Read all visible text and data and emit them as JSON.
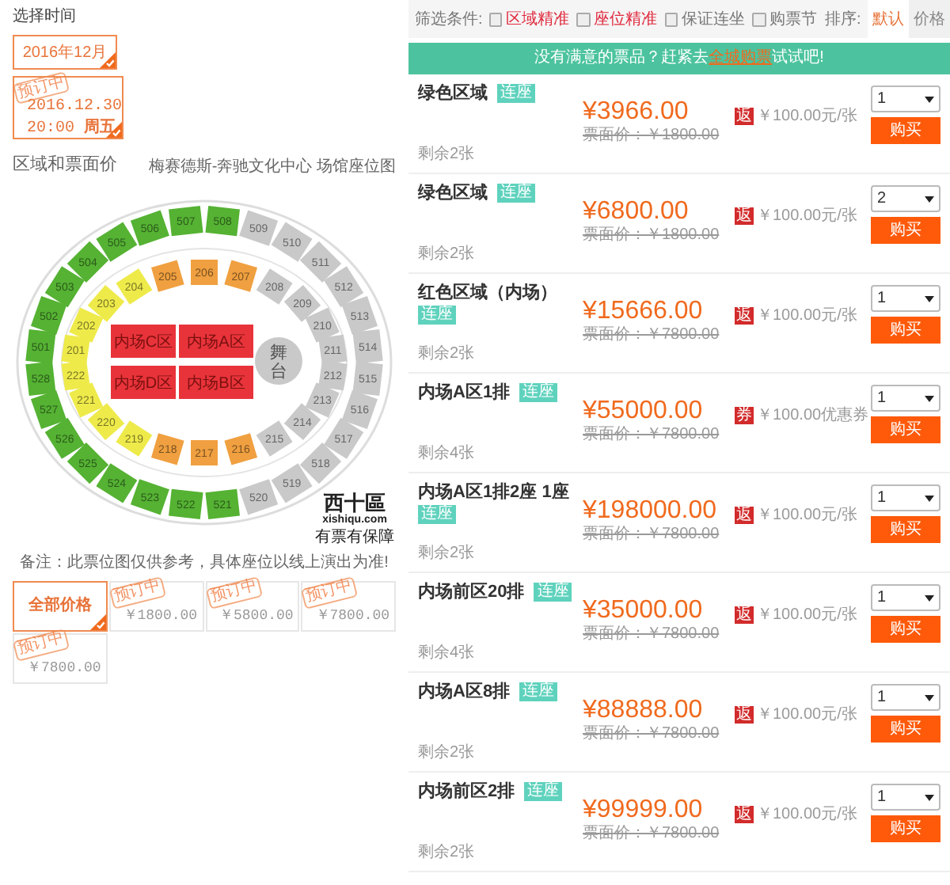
{
  "left": {
    "time_heading": "选择时间",
    "time_options": [
      {
        "label": "2016年12月",
        "selected": true
      }
    ],
    "sessions": [
      {
        "date": "2016.12.30",
        "time": "20:00",
        "weekday": "周五",
        "stamp": "预订中",
        "selected": true
      }
    ],
    "zone_heading": "区域和票面价",
    "venue_map_title": "梅赛德斯-奔驰文化中心 场馆座位图",
    "seat_map": {
      "outer_ring": [
        {
          "label": "501",
          "color": "#55b233"
        },
        {
          "label": "502",
          "color": "#55b233"
        },
        {
          "label": "503",
          "color": "#55b233"
        },
        {
          "label": "504",
          "color": "#55b233"
        },
        {
          "label": "505",
          "color": "#55b233"
        },
        {
          "label": "506",
          "color": "#55b233"
        },
        {
          "label": "507",
          "color": "#55b233"
        },
        {
          "label": "508",
          "color": "#55b233"
        },
        {
          "label": "509",
          "color": "#c9c9c9"
        },
        {
          "label": "510",
          "color": "#c9c9c9"
        },
        {
          "label": "511",
          "color": "#c9c9c9"
        },
        {
          "label": "512",
          "color": "#c9c9c9"
        },
        {
          "label": "513",
          "color": "#c9c9c9"
        },
        {
          "label": "514",
          "color": "#c9c9c9"
        },
        {
          "label": "515",
          "color": "#c9c9c9"
        },
        {
          "label": "516",
          "color": "#c9c9c9"
        },
        {
          "label": "517",
          "color": "#c9c9c9"
        },
        {
          "label": "518",
          "color": "#c9c9c9"
        },
        {
          "label": "519",
          "color": "#c9c9c9"
        },
        {
          "label": "520",
          "color": "#c9c9c9"
        },
        {
          "label": "521",
          "color": "#55b233"
        },
        {
          "label": "522",
          "color": "#55b233"
        },
        {
          "label": "523",
          "color": "#55b233"
        },
        {
          "label": "524",
          "color": "#55b233"
        },
        {
          "label": "525",
          "color": "#55b233"
        },
        {
          "label": "526",
          "color": "#55b233"
        },
        {
          "label": "527",
          "color": "#55b233"
        },
        {
          "label": "528",
          "color": "#55b233"
        }
      ],
      "middle_ring": [
        {
          "label": "201",
          "color": "#eeea4a"
        },
        {
          "label": "202",
          "color": "#eeea4a"
        },
        {
          "label": "203",
          "color": "#eeea4a"
        },
        {
          "label": "204",
          "color": "#eeea4a"
        },
        {
          "label": "205",
          "color": "#f0a040"
        },
        {
          "label": "206",
          "color": "#f0a040"
        },
        {
          "label": "207",
          "color": "#f0a040"
        },
        {
          "label": "208",
          "color": "#c9c9c9"
        },
        {
          "label": "209",
          "color": "#c9c9c9"
        },
        {
          "label": "210",
          "color": "#c9c9c9"
        },
        {
          "label": "211",
          "color": "#c9c9c9"
        },
        {
          "label": "212",
          "color": "#c9c9c9"
        },
        {
          "label": "213",
          "color": "#c9c9c9"
        },
        {
          "label": "214",
          "color": "#c9c9c9"
        },
        {
          "label": "215",
          "color": "#c9c9c9"
        },
        {
          "label": "216",
          "color": "#f0a040"
        },
        {
          "label": "217",
          "color": "#f0a040"
        },
        {
          "label": "218",
          "color": "#f0a040"
        },
        {
          "label": "219",
          "color": "#eeea4a"
        },
        {
          "label": "220",
          "color": "#eeea4a"
        },
        {
          "label": "221",
          "color": "#eeea4a"
        },
        {
          "label": "222",
          "color": "#eeea4a"
        }
      ],
      "floor_blocks": [
        {
          "label": "内场C区",
          "color": "#e8333a"
        },
        {
          "label": "内场A区",
          "color": "#e8333a"
        },
        {
          "label": "内场D区",
          "color": "#e8333a"
        },
        {
          "label": "内场B区",
          "color": "#e8333a"
        }
      ],
      "stage": "舞台",
      "logo": {
        "wordmark": "西十區",
        "url": "xishiqu.com",
        "slogan": "有票有保障"
      }
    },
    "note": "备注：此票位图仅供参考，具体座位以线上演出为准!",
    "price_filters": [
      {
        "label": "全部价格",
        "selected": true
      },
      {
        "label": "￥1800.00",
        "stamp": "预订中",
        "selected": false
      },
      {
        "label": "￥5800.00",
        "stamp": "预订中",
        "selected": false
      },
      {
        "label": "￥7800.00",
        "stamp": "预订中",
        "selected": false
      },
      {
        "label": "￥7800.00",
        "stamp": "预订中",
        "selected": false
      }
    ]
  },
  "filters": {
    "label": "筛选条件:",
    "options": [
      {
        "label": "区域精准",
        "checked": false,
        "highlight": true
      },
      {
        "label": "座位精准",
        "checked": false,
        "highlight": true
      },
      {
        "label": "保证连坐",
        "checked": false,
        "highlight": false
      },
      {
        "label": "购票节",
        "checked": false,
        "highlight": false
      }
    ],
    "sort_label": "排序:",
    "sort_tabs": [
      {
        "label": "默认",
        "selected": true
      },
      {
        "label": "价格",
        "selected": false
      }
    ]
  },
  "banner": {
    "before": "没有满意的票品？赶紧去",
    "link": "全城购票",
    "after": "试试吧!"
  },
  "listings": [
    {
      "name": "绿色区域",
      "badge": "连座",
      "price": "¥3966.00",
      "face_price": "票面价：￥1800.00",
      "rebate_icon": "返",
      "rebate": "￥100.00元/张",
      "remaining": "剩余2张",
      "quantity": "1",
      "button": "购买"
    },
    {
      "name": "绿色区域",
      "badge": "连座",
      "price": "¥6800.00",
      "face_price": "票面价：￥1800.00",
      "rebate_icon": "返",
      "rebate": "￥100.00元/张",
      "remaining": "剩余2张",
      "quantity": "2",
      "button": "购买"
    },
    {
      "name": "红色区域（内场）",
      "badge": "连座",
      "price": "¥15666.00",
      "face_price": "票面价：￥7800.00",
      "rebate_icon": "返",
      "rebate": "￥100.00元/张",
      "remaining": "剩余2张",
      "quantity": "1",
      "button": "购买"
    },
    {
      "name": "内场A区1排",
      "badge": "连座",
      "price": "¥55000.00",
      "face_price": "票面价：￥7800.00",
      "rebate_icon": "券",
      "rebate": "￥100.00优惠券",
      "remaining": "剩余4张",
      "quantity": "1",
      "button": "购买"
    },
    {
      "name": "内场A区1排2座 1座",
      "badge": "连座",
      "price": "¥198000.00",
      "face_price": "票面价：￥7800.00",
      "rebate_icon": "返",
      "rebate": "￥100.00元/张",
      "remaining": "剩余2张",
      "quantity": "1",
      "button": "购买"
    },
    {
      "name": "内场前区20排",
      "badge": "连座",
      "price": "¥35000.00",
      "face_price": "票面价：￥7800.00",
      "rebate_icon": "返",
      "rebate": "￥100.00元/张",
      "remaining": "剩余4张",
      "quantity": "1",
      "button": "购买"
    },
    {
      "name": "内场A区8排",
      "badge": "连座",
      "price": "¥88888.00",
      "face_price": "票面价：￥7800.00",
      "rebate_icon": "返",
      "rebate": "￥100.00元/张",
      "remaining": "剩余2张",
      "quantity": "1",
      "button": "购买"
    },
    {
      "name": "内场前区2排",
      "badge": "连座",
      "price": "¥99999.00",
      "face_price": "票面价：￥7800.00",
      "rebate_icon": "返",
      "rebate": "￥100.00元/张",
      "remaining": "剩余2张",
      "quantity": "1",
      "button": "购买"
    }
  ]
}
